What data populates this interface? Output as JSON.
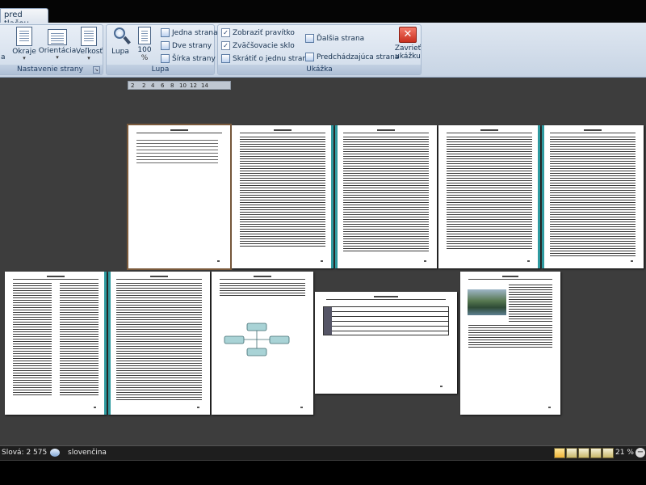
{
  "tab": {
    "label": "pred tlačou"
  },
  "ribbon": {
    "page_setup": {
      "label": "Nastavenie strany",
      "margins": "Okraje",
      "orientation": "Orientácia",
      "size": "Veľkosť",
      "left_cut": "a"
    },
    "zoom": {
      "label": "Lupa",
      "zoom_btn": "Lupa",
      "hundred": "100",
      "hundred_unit": "%",
      "one_page": "Jedna strana",
      "two_pages": "Dve strany",
      "page_width": "Šírka strany"
    },
    "preview": {
      "label": "Ukážka",
      "show_ruler": "Zobraziť pravítko",
      "magnifier": "Zväčšovacie sklo",
      "shrink": "Skrátiť o jednu stranu",
      "next_page": "Ďalšia strana",
      "prev_page": "Predchádzajúca strana",
      "close_line1": "Zavrieť",
      "close_line2": "ukážku"
    }
  },
  "ruler": {
    "ticks": [
      "2",
      "2",
      "4",
      "6",
      "8",
      "10",
      "12",
      "14"
    ]
  },
  "status": {
    "words": "Slová: 2 575",
    "language": "slovenčina",
    "zoom": "21 %"
  },
  "colors": {
    "accent_teal": "#2f9aa0",
    "background": "#3d3d3d",
    "selected_page": "#7a5a3c"
  },
  "icons": [
    "page-icon",
    "orientation-icon",
    "size-icon",
    "magnifier-icon",
    "one-page-icon",
    "two-pages-icon",
    "page-width-icon",
    "check-icon",
    "next-page-icon",
    "prev-page-icon",
    "close-icon",
    "language-icon",
    "zoom-out-icon"
  ]
}
